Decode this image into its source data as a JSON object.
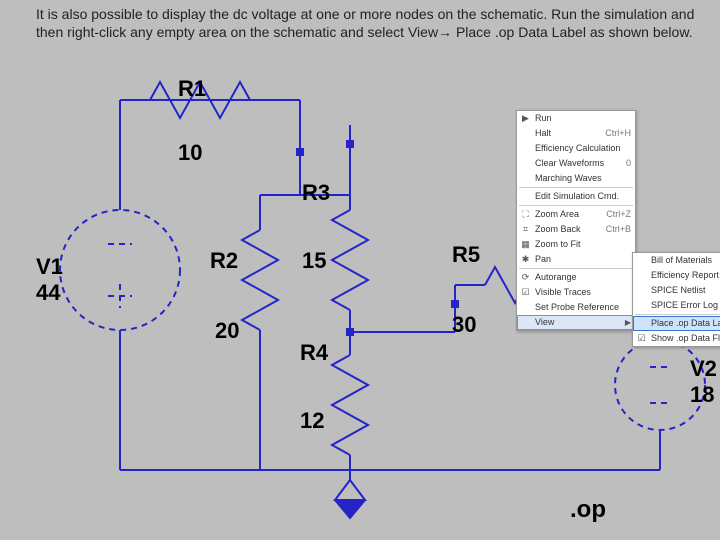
{
  "instruction": "It is also possible to display the dc voltage at one or more nodes on the schematic. Run the simulation and then right-click any empty area on the schematic and select View→ Place .op Data Label as shown below.",
  "components": {
    "R1": {
      "label": "R1",
      "value": "10"
    },
    "R2": {
      "label": "R2",
      "value": "20"
    },
    "R3": {
      "label": "R3",
      "value": "15"
    },
    "R4": {
      "label": "R4",
      "value": "12"
    },
    "R5": {
      "label": "R5",
      "value": "30"
    },
    "V1": {
      "label": "V1",
      "value": "44"
    },
    "V2": {
      "label": "V2",
      "value": "18"
    }
  },
  "directive": ".op",
  "menu1": {
    "items": [
      {
        "icon": "▶",
        "label": "Run",
        "hk": ""
      },
      {
        "icon": "",
        "label": "Halt",
        "hk": "Ctrl+H"
      },
      {
        "icon": "",
        "label": "Efficiency Calculation",
        "hk": ""
      },
      {
        "icon": "",
        "label": "Clear Waveforms",
        "hk": "0"
      },
      {
        "icon": "",
        "label": "Marching Waves",
        "hk": ""
      },
      {
        "sep": true
      },
      {
        "icon": "",
        "label": "Edit Simulation Cmd.",
        "hk": ""
      },
      {
        "sep": true
      },
      {
        "icon": "⛶",
        "label": "Zoom Area",
        "hk": "Ctrl+Z"
      },
      {
        "icon": "⌗",
        "label": "Zoom Back",
        "hk": "Ctrl+B"
      },
      {
        "icon": "▦",
        "label": "Zoom to Fit",
        "hk": ""
      },
      {
        "icon": "✱",
        "label": "Pan",
        "hk": ""
      },
      {
        "sep": true
      },
      {
        "icon": "⟳",
        "label": "Autorange",
        "hk": ""
      },
      {
        "icon": "☑",
        "label": "Visible Traces",
        "hk": ""
      },
      {
        "icon": "",
        "label": "Set Probe Reference",
        "hk": ""
      },
      {
        "icon": "",
        "label": "View",
        "sub": true,
        "selected": true
      }
    ]
  },
  "menu2": {
    "items": [
      {
        "icon": "",
        "label": "Bill of Materials"
      },
      {
        "icon": "",
        "label": "Efficiency Report"
      },
      {
        "icon": "",
        "label": "SPICE Netlist"
      },
      {
        "icon": "",
        "label": "SPICE Error Log"
      },
      {
        "sep": true
      },
      {
        "icon": "",
        "label": "Place .op Data Label",
        "hl": true
      },
      {
        "icon": "☑",
        "label": "Show .op Data Flags"
      }
    ]
  }
}
